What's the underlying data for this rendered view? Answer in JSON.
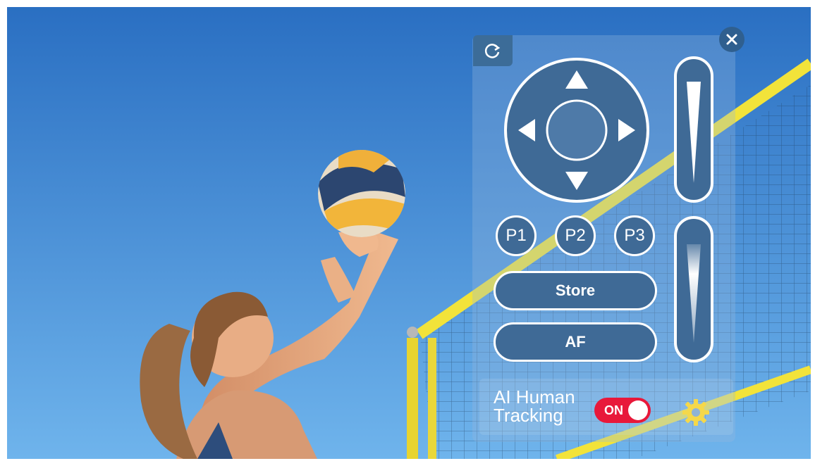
{
  "ptz_panel": {
    "presets": [
      {
        "label": "P1"
      },
      {
        "label": "P2"
      },
      {
        "label": "P3"
      }
    ],
    "store_label": "Store",
    "af_label": "AF",
    "tracking": {
      "label_line1": "AI Human",
      "label_line2": "Tracking",
      "toggle_state": "ON"
    }
  },
  "icons": {
    "refresh": "refresh-icon",
    "close": "close-icon",
    "settings": "gear-icon"
  },
  "colors": {
    "panel_blue": "#3f6a96",
    "toggle_on": "#e8183a"
  }
}
